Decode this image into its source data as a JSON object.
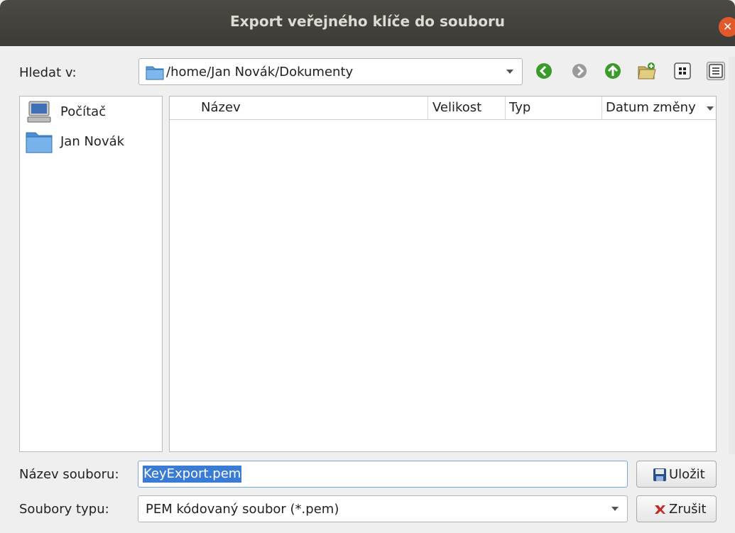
{
  "window": {
    "title": "Export veřejného klíče do souboru"
  },
  "lookin": {
    "label": "Hledat v:",
    "path": "/home/Jan Novák/Dokumenty"
  },
  "sidebar": {
    "items": [
      {
        "label": "Počítač",
        "icon": "computer-icon"
      },
      {
        "label": "Jan Novák",
        "icon": "folder-icon"
      }
    ]
  },
  "columns": {
    "name": "Název",
    "size": "Velikost",
    "type": "Typ",
    "date": "Datum změny"
  },
  "filename": {
    "label": "Název souboru:",
    "value": "KeyExport.pem"
  },
  "filetype": {
    "label": "Soubory typu:",
    "value": "PEM kódovaný soubor (*.pem)"
  },
  "buttons": {
    "save": "Uložit",
    "cancel": "Zrušit"
  },
  "colors": {
    "accent": "#3a7bd5",
    "nav_green": "#3a9a2a",
    "close": "#e2592b"
  }
}
